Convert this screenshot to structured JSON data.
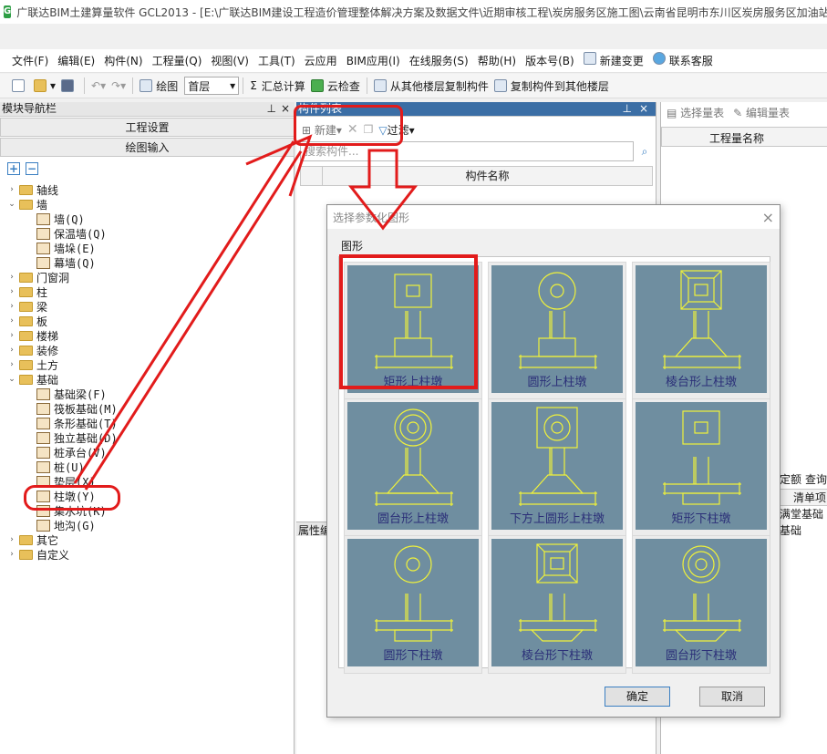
{
  "window": {
    "title": "广联达BIM土建算量软件 GCL2013 - [E:\\广联达BIM建设工程造价管理整体解决方案及数据文件\\近期审核工程\\炭房服务区施工图\\云南省昆明市东川区炭房服务区加油站"
  },
  "menu": [
    "文件(F)",
    "编辑(E)",
    "构件(N)",
    "工程量(Q)",
    "视图(V)",
    "工具(T)",
    "云应用",
    "BIM应用(I)",
    "在线服务(S)",
    "帮助(H)",
    "版本号(B)",
    "新建变更",
    "联系客服"
  ],
  "toolbar": {
    "draw": "绘图",
    "floor": "首层",
    "sum": "汇总计算",
    "cloud_check": "云检查",
    "copy_from": "从其他楼层复制构件",
    "copy_to": "复制构件到其他楼层"
  },
  "left_panel": {
    "title": "模块导航栏",
    "btn_settings": "工程设置",
    "btn_draw": "绘图输入",
    "tree": [
      {
        "label": "轴线",
        "level": 0,
        "type": "folder",
        "twisty": "›"
      },
      {
        "label": "墙",
        "level": 0,
        "type": "folder",
        "twisty": "⌄"
      },
      {
        "label": "墙(Q)",
        "level": 1,
        "type": "leaf"
      },
      {
        "label": "保温墙(Q)",
        "level": 1,
        "type": "leaf"
      },
      {
        "label": "墙垛(E)",
        "level": 1,
        "type": "leaf"
      },
      {
        "label": "幕墙(Q)",
        "level": 1,
        "type": "leaf"
      },
      {
        "label": "门窗洞",
        "level": 0,
        "type": "folder",
        "twisty": "›"
      },
      {
        "label": "柱",
        "level": 0,
        "type": "folder",
        "twisty": "›"
      },
      {
        "label": "梁",
        "level": 0,
        "type": "folder",
        "twisty": "›"
      },
      {
        "label": "板",
        "level": 0,
        "type": "folder",
        "twisty": "›"
      },
      {
        "label": "楼梯",
        "level": 0,
        "type": "folder",
        "twisty": "›"
      },
      {
        "label": "装修",
        "level": 0,
        "type": "folder",
        "twisty": "›"
      },
      {
        "label": "土方",
        "level": 0,
        "type": "folder",
        "twisty": "›"
      },
      {
        "label": "基础",
        "level": 0,
        "type": "folder",
        "twisty": "⌄"
      },
      {
        "label": "基础梁(F)",
        "level": 1,
        "type": "leaf"
      },
      {
        "label": "筏板基础(M)",
        "level": 1,
        "type": "leaf"
      },
      {
        "label": "条形基础(T)",
        "level": 1,
        "type": "leaf"
      },
      {
        "label": "独立基础(D)",
        "level": 1,
        "type": "leaf"
      },
      {
        "label": "桩承台(V)",
        "level": 1,
        "type": "leaf"
      },
      {
        "label": "桩(U)",
        "level": 1,
        "type": "leaf"
      },
      {
        "label": "垫层(X)",
        "level": 1,
        "type": "leaf"
      },
      {
        "label": "柱墩(Y)",
        "level": 1,
        "type": "leaf"
      },
      {
        "label": "集水坑(K)",
        "level": 1,
        "type": "leaf"
      },
      {
        "label": "地沟(G)",
        "level": 1,
        "type": "leaf"
      },
      {
        "label": "其它",
        "level": 0,
        "type": "folder",
        "twisty": "›"
      },
      {
        "label": "自定义",
        "level": 0,
        "type": "folder",
        "twisty": "›"
      }
    ]
  },
  "comp_panel": {
    "title": "构件列表",
    "new": "新建",
    "filter": "过滤",
    "search_placeholder": "搜索构件...",
    "col_name": "构件名称",
    "props_title": "属性编"
  },
  "right_panel": {
    "select_table": "选择量表",
    "edit_table": "编辑量表",
    "col_qty": "工程量名称",
    "tab_quota": "定额",
    "tab_query": "查询",
    "col_item": "清单项",
    "row1": "满堂基础",
    "row2": "基础"
  },
  "dialog": {
    "title": "选择参数化图形",
    "group": "图形",
    "shapes": [
      "矩形上柱墩",
      "圆形上柱墩",
      "棱台形上柱墩",
      "圆台形上柱墩",
      "下方上圆形上柱墩",
      "矩形下柱墩",
      "圆形下柱墩",
      "棱台形下柱墩",
      "圆台形下柱墩"
    ],
    "ok": "确定",
    "cancel": "取消"
  },
  "colors": {
    "accent_red": "#e21b1b",
    "preview_bg": "#6f8ea0",
    "preview_line": "#f0f23a",
    "label_blue": "#2b2f78"
  }
}
